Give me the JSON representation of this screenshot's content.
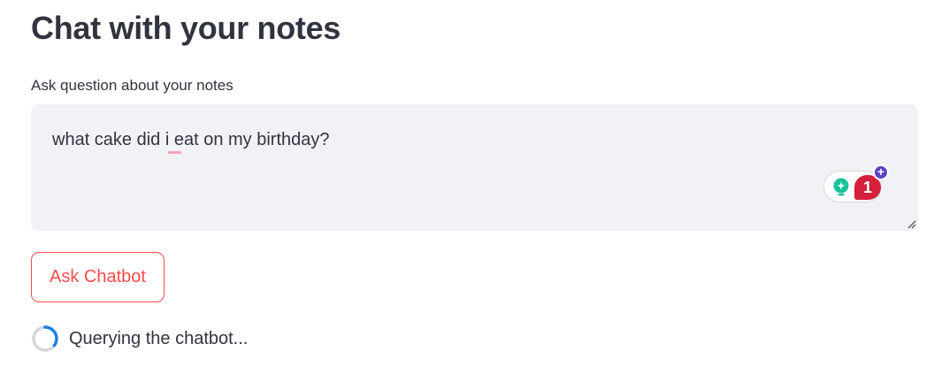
{
  "page": {
    "title": "Chat with your notes"
  },
  "question": {
    "label": "Ask question about your notes",
    "value": "what cake did i eat on my birthday?"
  },
  "grammar_widget": {
    "count": "1",
    "plus": "+"
  },
  "actions": {
    "ask_label": "Ask Chatbot"
  },
  "status": {
    "text": "Querying the chatbot..."
  },
  "colors": {
    "accent": "#ff4b4b",
    "input_background": "#f0f2f6",
    "spinner": "#1c83e1",
    "text": "#31333f"
  },
  "icons": {
    "grammar_suggestion": "lightbulb-icon",
    "spinner": "loading-spinner-icon",
    "resize": "resize-handle-icon"
  }
}
